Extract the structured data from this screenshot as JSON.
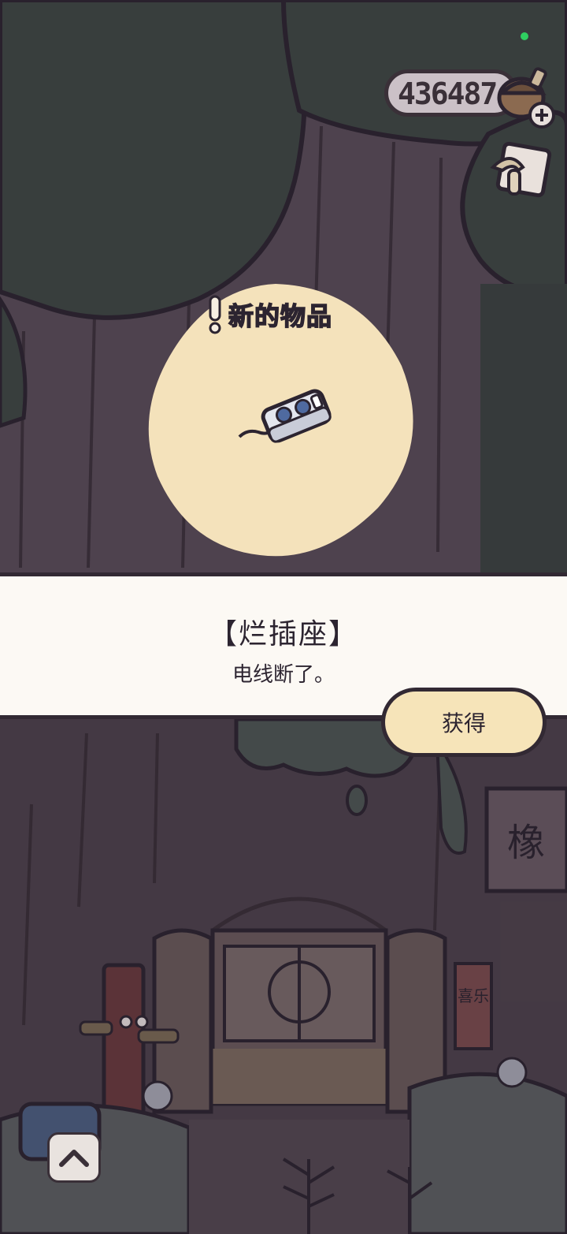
{
  "hud": {
    "coin_count": "436487",
    "acorn_icon": "acorn-plus-icon",
    "card_icon": "postcard-icon"
  },
  "popup": {
    "banner_label": "新的物品",
    "item_icon": "power-strip-icon",
    "item_name": "【烂插座】",
    "item_description": "电线断了。",
    "obtain_label": "获得"
  },
  "scene": {
    "collapse_icon": "chevron-up-icon",
    "sign_text": "橡",
    "lantern_text": "喜乐"
  },
  "colors": {
    "panel_bg": "#fcf9f4",
    "button_bg": "#f6e4b9",
    "blob_bg": "#f4e2bb",
    "status_dot": "#2fd061"
  }
}
